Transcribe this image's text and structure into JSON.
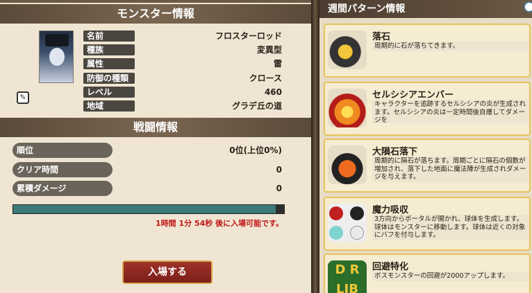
{
  "monster_info": {
    "header": "モンスター情報",
    "rows": [
      {
        "label": "名前",
        "value": "フロスターロッド"
      },
      {
        "label": "種族",
        "value": "変異型"
      },
      {
        "label": "属性",
        "value": "雷"
      },
      {
        "label": "防御の種類",
        "value": "クロース"
      },
      {
        "label": "レベル",
        "value": "460"
      },
      {
        "label": "地域",
        "value": "グラデ丘の道"
      }
    ]
  },
  "battle_info": {
    "header": "戦闘情報",
    "rows": [
      {
        "label": "順位",
        "value": "0位(上位0%)"
      },
      {
        "label": "クリア時間",
        "value": "0"
      },
      {
        "label": "累積ダメージ",
        "value": "0"
      }
    ],
    "progress": 0.97,
    "reentry_text": "1時間 1分 54秒 後に入場可能です。"
  },
  "enter_button": "入場する",
  "weekly": {
    "header": "週間パターン情報",
    "cards": [
      {
        "title": "落石",
        "desc": "周期的に石が落ちてきます。",
        "icon": "falling-rock-icon"
      },
      {
        "title": "セルシシアエンバー",
        "desc": "キャラクターを追跡するセルシシアの炎が生成されます。セルシシアの炎は一定時間後自爆してダメージを",
        "icon": "fire-ember-icon"
      },
      {
        "title": "大隕石落下",
        "desc": "周期的に隕石が落ちます。周期ごとに隕石の個数が増加され、落下した地面に魔法陣が生成されダメージを与えます。",
        "icon": "meteor-icon"
      },
      {
        "title": "魔力吸収",
        "desc": "3方向からポータルが開かれ、球体を生成します。球体はモンスターに移動します。球体は近くの対象にバフを付与します。",
        "icon": "mana-orbs-icon"
      },
      {
        "title": "回避特化",
        "desc": "ボスモンスターの回避が2000アップします。",
        "icon": "dr-badge-icon",
        "icon_text": "D R\nLIB"
      }
    ]
  }
}
